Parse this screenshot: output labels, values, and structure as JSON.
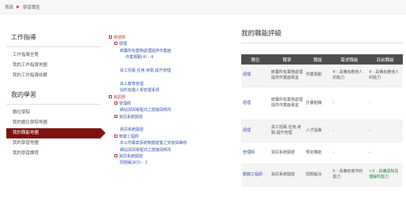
{
  "breadcrumb": {
    "home": "首頁",
    "current": "學習專區"
  },
  "sidebar": {
    "section1_title": "工作指導",
    "section1_items": [
      "工作指導全覽",
      "我的工作指導地圖",
      "我的工作指導收藏"
    ],
    "section2_title": "我的學習",
    "section2_items": [
      "戲位學院",
      "我的戲位學院地圖",
      "我的職能地圖",
      "我的學習地圖",
      "我的學習課程"
    ],
    "active_item": "我的職能地圖"
  },
  "tree": [
    {
      "text": "營運部",
      "level": 0,
      "kind": "org"
    },
    {
      "text": "經理",
      "level": 1,
      "kind": "role"
    },
    {
      "text": "統籌所有業務處理提供作業面",
      "level": 2,
      "kind": "link"
    },
    {
      "text": "作業規劃(4) - 4",
      "level": 3,
      "kind": "link"
    },
    {
      "text": "",
      "level": 0,
      "kind": "blank"
    },
    {
      "text": "員工招募,任用,考勤,提升管理",
      "level": 2,
      "kind": "link"
    },
    {
      "text": "",
      "level": 0,
      "kind": "blank"
    },
    {
      "text": "員工教育管理",
      "level": 2,
      "kind": "link"
    },
    {
      "text": "與所有團人事管理事項",
      "level": 2,
      "kind": "link"
    },
    {
      "text": "資訊部",
      "level": 0,
      "kind": "org"
    },
    {
      "text": "管理師",
      "level": 1,
      "kind": "role"
    },
    {
      "text": "網站與與電程式之建議與修改",
      "level": 2,
      "kind": "link"
    },
    {
      "text": "資訊系統開發",
      "level": 1,
      "kind": "role"
    },
    {
      "text": "",
      "level": 0,
      "kind": "blank"
    },
    {
      "text": "資訊系統開發",
      "level": 2,
      "kind": "link"
    },
    {
      "text": "軟體工程師",
      "level": 1,
      "kind": "role"
    },
    {
      "text": "本公司專案系統軟體建置之安裝與維修",
      "level": 2,
      "kind": "link"
    },
    {
      "text": "網站與與電程式之建議與修改",
      "level": 2,
      "kind": "link"
    },
    {
      "text": "資訊系統開發",
      "level": 1,
      "kind": "role"
    },
    {
      "text": "問題解決(5) - 1",
      "level": 2,
      "kind": "link"
    }
  ],
  "main": {
    "title": "我的職能評級",
    "headers": [
      "職位",
      "職掌",
      "職能",
      "需求職級",
      "目前職級"
    ],
    "rows": [
      {
        "position": "經理",
        "duty": "統籌所有業務處理提供作業面事宜",
        "competency": "作業規劃",
        "required": "4 - 具備有教他人的能力",
        "current": "4 - 具備有教他人的能力"
      },
      {
        "position": "經理",
        "duty": "統籌所有業務處理提供作業面事宜",
        "competency": "計畫組織",
        "required": "-",
        "current": "-"
      },
      {
        "position": "經理",
        "duty": "員工招募,任用,考勤,提升管理",
        "competency": "人才提楊",
        "required": "-",
        "current": "-"
      },
      {
        "position": "管理師",
        "duty": "資訊系統開發",
        "competency": "預定職能",
        "required": "-",
        "current": "-"
      },
      {
        "position": "軟體工程師",
        "duty": "資訊系統開發",
        "competency": "問題解決",
        "required": "5 - 具備有寫作的能力",
        "current": ">1 - 具備認知及理解的能力"
      }
    ]
  },
  "colors": {
    "accent": "#7f1212",
    "link": "#3a56b0",
    "org": "#c0392b",
    "header_bg": "#4d4d4d"
  }
}
